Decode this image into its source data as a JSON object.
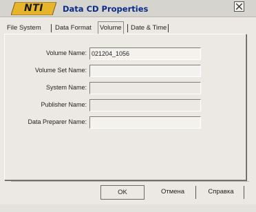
{
  "window": {
    "logo_text": "NTI",
    "title": "Data CD Properties"
  },
  "tabs": [
    {
      "label": "File System",
      "active": false
    },
    {
      "label": "Data Format",
      "active": false
    },
    {
      "label": "Volume",
      "active": true
    },
    {
      "label": "Date & Time",
      "active": false
    }
  ],
  "form": {
    "volume_name": {
      "label": "Volume Name:",
      "value": "021204_1056"
    },
    "volume_set_name": {
      "label": "Volume Set Name:",
      "value": ""
    },
    "system_name": {
      "label": "System Name:",
      "value": ""
    },
    "publisher_name": {
      "label": "Publisher Name:",
      "value": ""
    },
    "data_preparer_name": {
      "label": "Data Preparer Name:",
      "value": ""
    }
  },
  "buttons": {
    "ok": "OK",
    "cancel": "Отмена",
    "help": "Справка"
  },
  "colors": {
    "title_text": "#0a2a8a",
    "logo_fill": "#e6b52c"
  }
}
